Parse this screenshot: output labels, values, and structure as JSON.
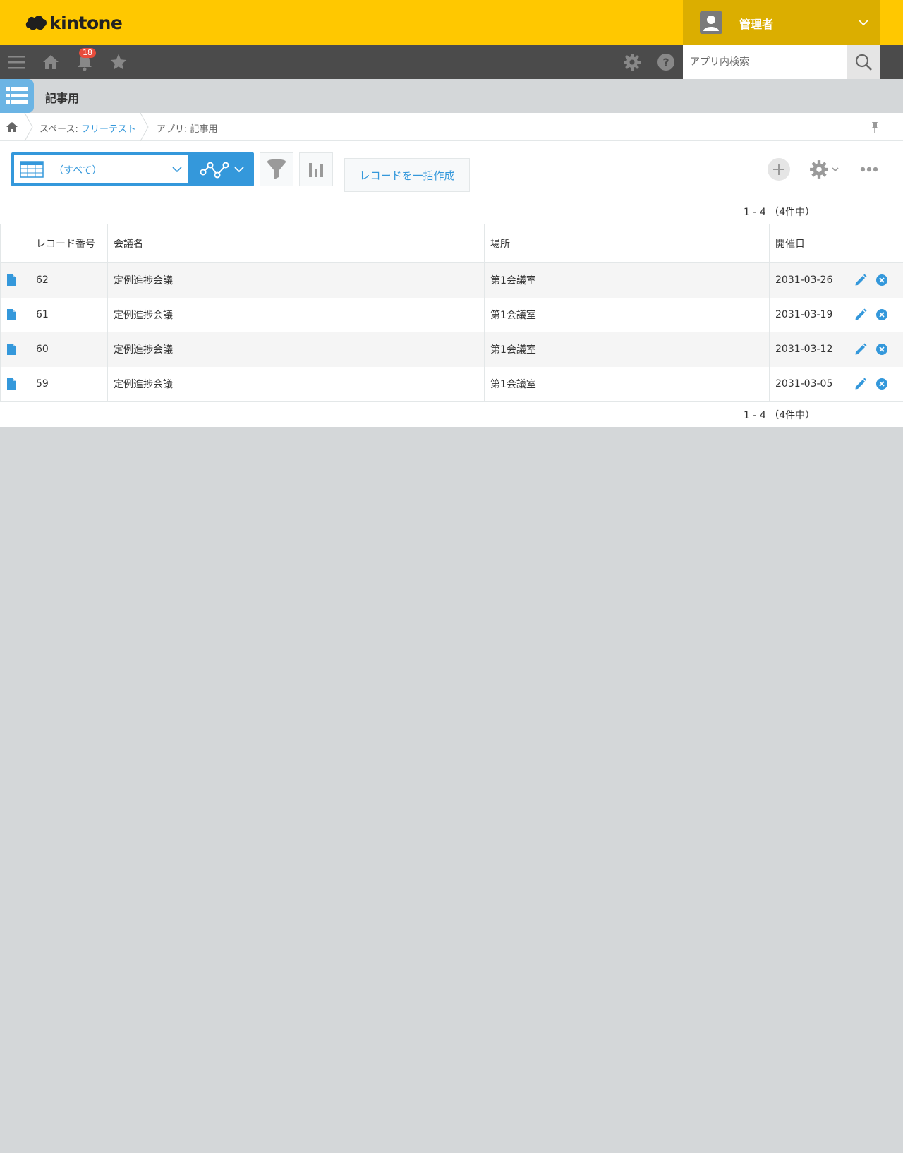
{
  "header": {
    "logo_text": "kintone",
    "user_name": "管理者"
  },
  "nav": {
    "notification_count": "18",
    "search_placeholder": "アプリ内検索"
  },
  "app": {
    "title": "記事用"
  },
  "breadcrumb": {
    "space_prefix": "スペース: ",
    "space_name": "フリーテスト",
    "app_label": "アプリ: 記事用"
  },
  "toolbar": {
    "view_label": "（すべて）",
    "bulk_create_label": "レコードを一括作成"
  },
  "pager": {
    "top": "1 - 4 （4件中）",
    "bottom": "1 - 4 （4件中）"
  },
  "table": {
    "columns": [
      "",
      "レコード番号",
      "会議名",
      "場所",
      "開催日",
      ""
    ],
    "rows": [
      {
        "id": "62",
        "name": "定例進捗会議",
        "place": "第1会議室",
        "date": "2031-03-26"
      },
      {
        "id": "61",
        "name": "定例進捗会議",
        "place": "第1会議室",
        "date": "2031-03-19"
      },
      {
        "id": "60",
        "name": "定例進捗会議",
        "place": "第1会議室",
        "date": "2031-03-12"
      },
      {
        "id": "59",
        "name": "定例進捗会議",
        "place": "第1会議室",
        "date": "2031-03-05"
      }
    ]
  },
  "colors": {
    "brand_yellow": "#ffc800",
    "user_area": "#dbae00",
    "navbar": "#4b4b4b",
    "accent_blue": "#3498db",
    "badge_red": "#e74c3c",
    "background": "#d4d7d9"
  },
  "icons": {
    "nav": [
      "menu-icon",
      "home-icon",
      "bell-icon",
      "star-icon",
      "gear-icon",
      "help-icon",
      "search-icon"
    ],
    "toolbar": [
      "table-view-icon",
      "chevron-down-icon",
      "graph-icon",
      "filter-icon",
      "chart-icon",
      "plus-icon",
      "gear-icon",
      "more-icon"
    ],
    "row": [
      "document-icon",
      "edit-icon",
      "delete-icon"
    ]
  }
}
